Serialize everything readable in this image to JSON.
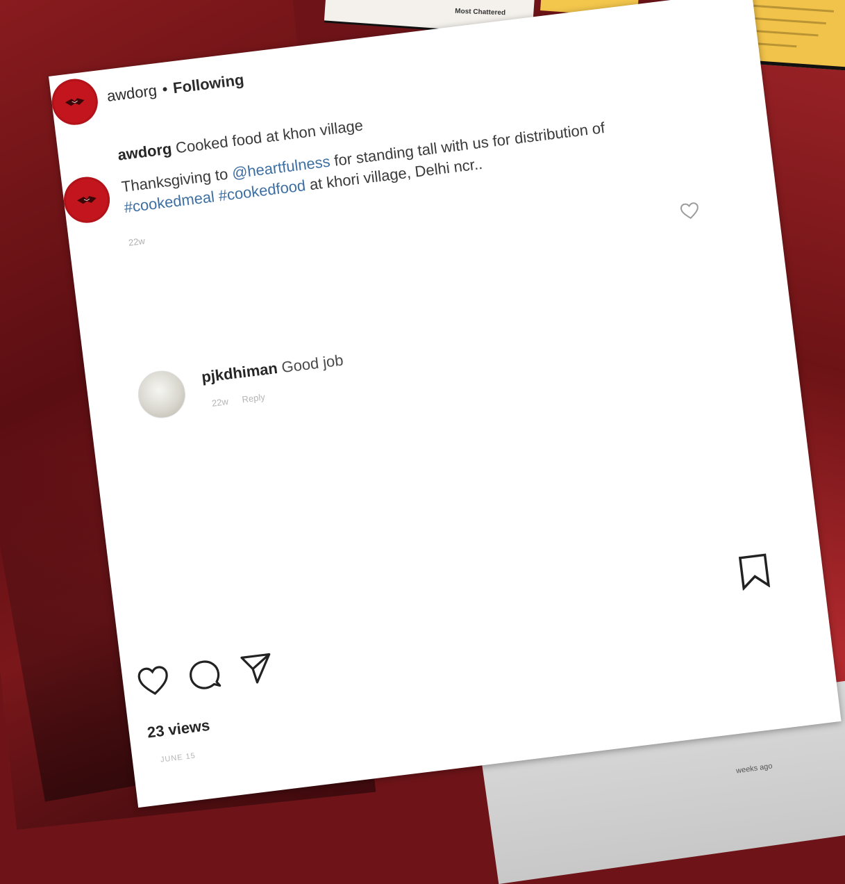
{
  "post": {
    "more_label": "•••",
    "header": {
      "username": "awdorg",
      "separator": "•",
      "follow_status": "Following"
    },
    "caption": {
      "username": "awdorg",
      "title": "Cooked food at khon village",
      "body_prefix": "Thanksgiving to ",
      "mention": "@heartfulness",
      "body_middle": " for standing tall with us for distribution of ",
      "tag1": "#cookedmeal",
      "tag2": "#cookedfood",
      "body_suffix": " at khori village, Delhi ncr..",
      "time": "22w"
    },
    "comment": {
      "username": "pjkdhiman",
      "text": "Good job",
      "time": "22w",
      "reply_label": "Reply"
    },
    "views": "23 views",
    "date": "JUNE 15"
  },
  "background": {
    "top_card_text": "Most Chattered",
    "bottom_card_text": "weeks ago"
  },
  "colors": {
    "brand_red": "#c3151d",
    "link_blue": "#3d6fa3",
    "note_yellow": "#f2c34a"
  },
  "icons": {
    "avatar": "awd-logo-icon",
    "comment_like": "heart-outline-icon",
    "save": "bookmark-icon",
    "like": "heart-outline-icon",
    "comment": "comment-bubble-icon",
    "share": "paper-plane-icon"
  }
}
